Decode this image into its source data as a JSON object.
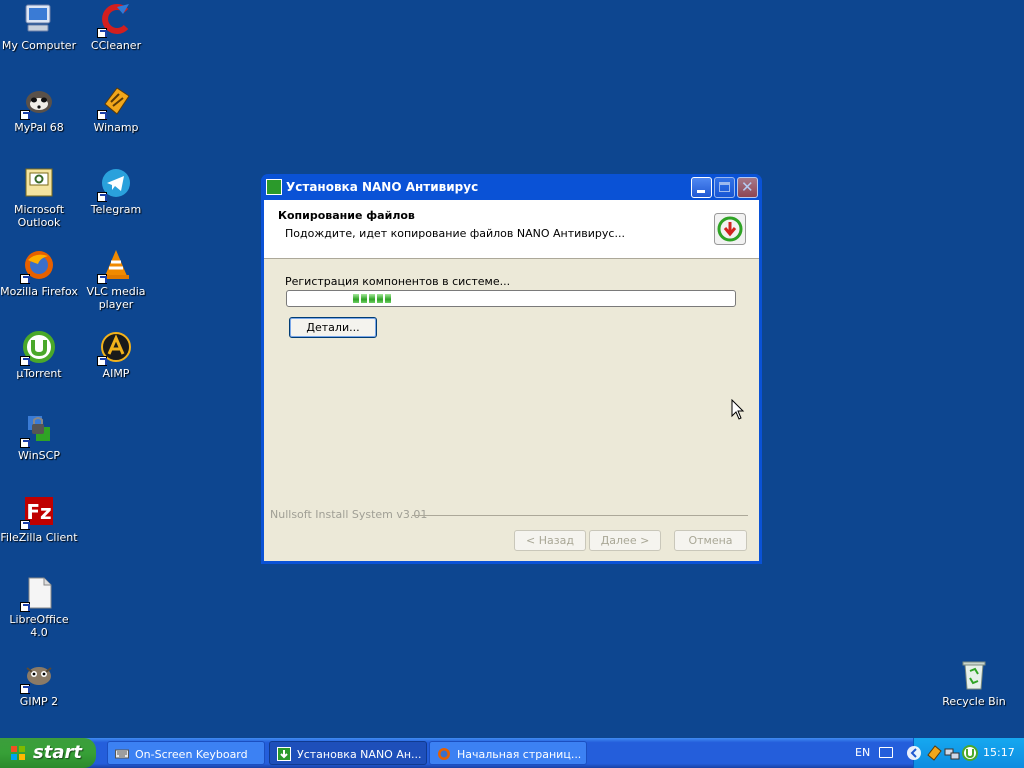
{
  "desktop": {
    "icons": [
      {
        "label": "My Computer"
      },
      {
        "label": "CCleaner"
      },
      {
        "label": "MyPal 68"
      },
      {
        "label": "Winamp"
      },
      {
        "label": "Microsoft Outlook"
      },
      {
        "label": "Telegram"
      },
      {
        "label": "Mozilla Firefox"
      },
      {
        "label": "VLC media player"
      },
      {
        "label": "µTorrent"
      },
      {
        "label": "AIMP"
      },
      {
        "label": "WinSCP"
      },
      {
        "label": "FileZilla Client"
      },
      {
        "label": "LibreOffice 4.0"
      },
      {
        "label": "GIMP 2"
      },
      {
        "label": "Recycle Bin"
      }
    ]
  },
  "window": {
    "title": "Установка NANO Антивирус",
    "header_title": "Копирование файлов",
    "header_subtitle": "Подождите, идет копирование файлов NANO Антивирус...",
    "status": "Регистрация компонентов в системе...",
    "details_button": "Детали...",
    "footer_brand": "Nullsoft Install System v3.01",
    "back_button": "< Назад",
    "next_button": "Далее >",
    "cancel_button": "Отмена"
  },
  "taskbar": {
    "start_label": "start",
    "tasks": [
      {
        "label": "On-Screen Keyboard"
      },
      {
        "label": "Установка NANO Ан..."
      },
      {
        "label": "Начальная страниц..."
      }
    ],
    "language": "EN",
    "clock": "15:17"
  },
  "colors": {
    "desktop_bg": "#0d4690",
    "titlebar": "#0a52d6",
    "progress_fill": "#2fa325",
    "taskbar": "#245edb",
    "start_button": "#37a037"
  }
}
